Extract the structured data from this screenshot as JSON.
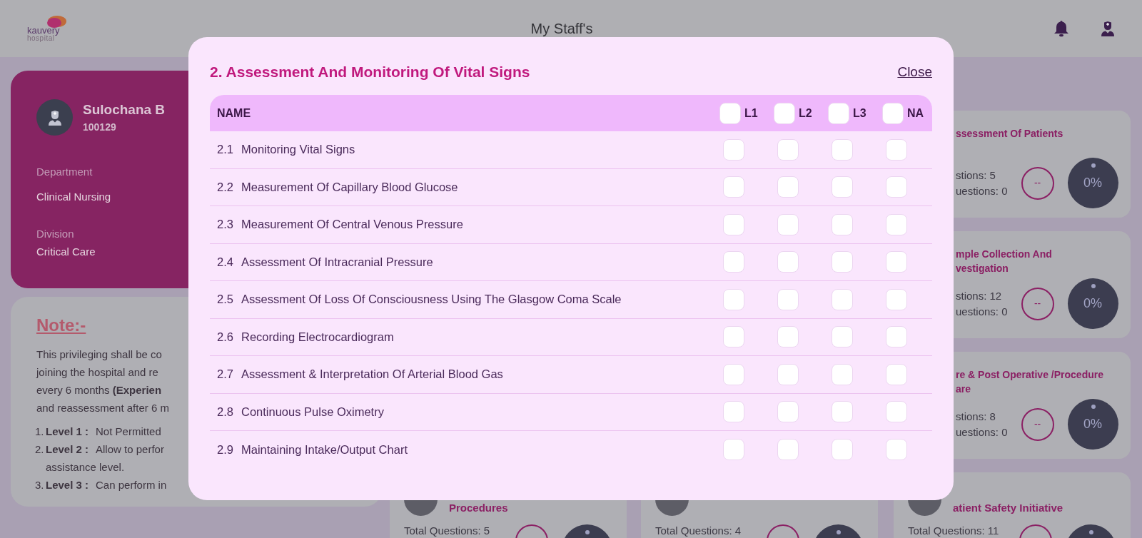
{
  "header": {
    "logo": {
      "name": "kauvery",
      "sub": "hospital"
    },
    "title": "My Staff's"
  },
  "profile": {
    "name": "Sulochana B",
    "id": "100129",
    "fields": [
      {
        "label": "Department",
        "value": "Clinical Nursing"
      },
      {
        "label": "Division",
        "value": "Critical Care"
      }
    ]
  },
  "note": {
    "heading": "Note:-",
    "lines": [
      "This privileging shall be co",
      "joining the hospital and re",
      "every 6 months **(Experien**",
      "and reassessment after 6 m"
    ],
    "levels": [
      {
        "number": "1.",
        "label": "Level 1 :",
        "lines": [
          "Not Permitted"
        ]
      },
      {
        "number": "2.",
        "label": "Level 2 :",
        "lines": [
          "Allow to perfor",
          "assistance level."
        ]
      },
      {
        "number": "3.",
        "label": "Level 3 :",
        "lines": [
          "Can perform in"
        ]
      }
    ]
  },
  "right_cards": [
    {
      "title": [
        "ssessment Of Patients"
      ],
      "lines": [
        "stions: 5",
        "uestions: 0"
      ],
      "ring": "--",
      "percent": "0%"
    },
    {
      "title": [
        "mple Collection And",
        "vestigation"
      ],
      "lines": [
        "stions: 12",
        "uestions: 0"
      ],
      "ring": "--",
      "percent": "0%"
    },
    {
      "title": [
        "re & Post Operative /Procedure",
        "are"
      ],
      "lines": [
        "stions: 8",
        "uestions: 0"
      ],
      "ring": "--",
      "percent": "0%"
    }
  ],
  "bottom_cards": [
    {
      "title": "Procedures",
      "lines": [
        "Total Questions: 5"
      ]
    },
    {
      "lines": [
        "Total Questions: 4"
      ]
    },
    {
      "title": "atient Safety Initiative",
      "lines": [
        "Total Questions: 11"
      ]
    }
  ],
  "modal": {
    "title": "2. Assessment And Monitoring Of Vital Signs",
    "close": "Close",
    "name_column": "NAME",
    "level_columns": [
      {
        "label": "L1",
        "checked": false
      },
      {
        "label": "L2",
        "checked": false
      },
      {
        "label": "L3",
        "checked": false
      },
      {
        "label": "NA",
        "checked": false
      }
    ],
    "rows": [
      {
        "number": "2.1",
        "name": "Monitoring Vital Signs",
        "checks": [
          {
            "checked": false
          },
          {
            "checked": false
          },
          {
            "checked": false
          },
          {
            "checked": false
          }
        ]
      },
      {
        "number": "2.2",
        "name": "Measurement Of Capillary Blood Glucose",
        "checks": [
          {
            "checked": false
          },
          {
            "checked": false
          },
          {
            "checked": false
          },
          {
            "checked": false
          }
        ]
      },
      {
        "number": "2.3",
        "name": "Measurement Of Central Venous Pressure",
        "checks": [
          {
            "checked": false
          },
          {
            "checked": false
          },
          {
            "checked": false
          },
          {
            "checked": false
          }
        ]
      },
      {
        "number": "2.4",
        "name": "Assessment Of Intracranial Pressure",
        "checks": [
          {
            "checked": false
          },
          {
            "checked": false
          },
          {
            "checked": false
          },
          {
            "checked": false
          }
        ]
      },
      {
        "number": "2.5",
        "name": "Assessment Of Loss Of Consciousness Using The Glasgow Coma Scale",
        "checks": [
          {
            "checked": false
          },
          {
            "checked": false
          },
          {
            "checked": false
          },
          {
            "checked": false
          }
        ]
      },
      {
        "number": "2.6",
        "name": "Recording Electrocardiogram",
        "checks": [
          {
            "checked": false
          },
          {
            "checked": false
          },
          {
            "checked": false
          },
          {
            "checked": false
          }
        ]
      },
      {
        "number": "2.7",
        "name": "Assessment & Interpretation Of Arterial Blood Gas",
        "checks": [
          {
            "checked": false
          },
          {
            "checked": false
          },
          {
            "checked": false
          },
          {
            "checked": false
          }
        ]
      },
      {
        "number": "2.8",
        "name": "Continuous Pulse Oximetry",
        "checks": [
          {
            "checked": false
          },
          {
            "checked": false
          },
          {
            "checked": false
          },
          {
            "checked": false
          }
        ]
      },
      {
        "number": "2.9",
        "name": "Maintaining Intake/Output Chart",
        "checks": [
          {
            "checked": false
          },
          {
            "checked": false
          },
          {
            "checked": false
          },
          {
            "checked": false
          }
        ]
      }
    ]
  }
}
